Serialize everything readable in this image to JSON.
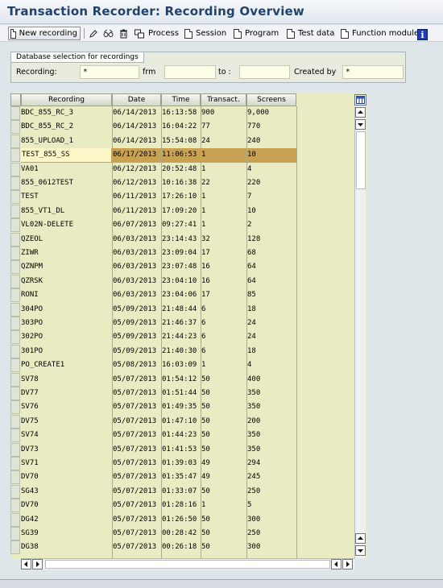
{
  "title": "Transaction Recorder: Recording Overview",
  "toolbar": {
    "new_recording": "New recording",
    "process": "Process",
    "session": "Session",
    "program": "Program",
    "test_data": "Test data",
    "function_module": "Function module"
  },
  "selection": {
    "group_title": "Database selection for recordings",
    "recording_label": "Recording:",
    "recording_value": "*",
    "from_label": "frm",
    "from_value": "",
    "to_label": "to :",
    "to_value": "",
    "created_by_label": "Created by",
    "created_by_value": "*"
  },
  "grid": {
    "columns": [
      "Recording",
      "Date",
      "Time",
      "Transact.",
      "Screens"
    ],
    "selected_row": 3,
    "rows": [
      [
        "BDC_855_RC_3",
        "06/14/2013",
        "16:13:58",
        "900",
        "9,000"
      ],
      [
        "BDC_855_RC_2",
        "06/14/2013",
        "16:04:22",
        "77",
        "770"
      ],
      [
        "855_UPLOAD_1",
        "06/14/2013",
        "15:54:08",
        "24",
        "240"
      ],
      [
        "TEST_855_SS",
        "06/17/2013",
        "11:06:53",
        "1",
        "10"
      ],
      [
        "VA01",
        "06/12/2013",
        "20:52:48",
        "1",
        "4"
      ],
      [
        "855_0612TEST",
        "06/12/2013",
        "10:16:38",
        "22",
        "220"
      ],
      [
        "TEST",
        "06/11/2013",
        "17:26:10",
        "1",
        "7"
      ],
      [
        "855_VT1_DL",
        "06/11/2013",
        "17:09:20",
        "1",
        "10"
      ],
      [
        "VL02N-DELETE",
        "06/07/2013",
        "09:27:41",
        "1",
        "2"
      ],
      [
        "QZEOL",
        "06/03/2013",
        "23:14:43",
        "32",
        "128"
      ],
      [
        "ZIWR",
        "06/03/2013",
        "23:09:04",
        "17",
        "68"
      ],
      [
        "QZNPM",
        "06/03/2013",
        "23:07:48",
        "16",
        "64"
      ],
      [
        "QZRSK",
        "06/03/2013",
        "23:04:10",
        "16",
        "64"
      ],
      [
        "RONI",
        "06/03/2013",
        "23:04:06",
        "17",
        "85"
      ],
      [
        "304PO",
        "05/09/2013",
        "21:48:44",
        "6",
        "18"
      ],
      [
        "303PO",
        "05/09/2013",
        "21:46:37",
        "6",
        "24"
      ],
      [
        "302PO",
        "05/09/2013",
        "21:44:23",
        "6",
        "24"
      ],
      [
        "301PO",
        "05/09/2013",
        "21:40:30",
        "6",
        "18"
      ],
      [
        "PO_CREATE1",
        "05/08/2013",
        "16:03:09",
        "1",
        "4"
      ],
      [
        "SV78",
        "05/07/2013",
        "01:54:12",
        "50",
        "400"
      ],
      [
        "DV77",
        "05/07/2013",
        "01:51:44",
        "50",
        "350"
      ],
      [
        "SV76",
        "05/07/2013",
        "01:49:35",
        "50",
        "350"
      ],
      [
        "DV75",
        "05/07/2013",
        "01:47:10",
        "50",
        "200"
      ],
      [
        "SV74",
        "05/07/2013",
        "01:44:23",
        "50",
        "350"
      ],
      [
        "DV73",
        "05/07/2013",
        "01:41:53",
        "50",
        "350"
      ],
      [
        "SV71",
        "05/07/2013",
        "01:39:03",
        "49",
        "294"
      ],
      [
        "DV70",
        "05/07/2013",
        "01:35:47",
        "49",
        "245"
      ],
      [
        "SG43",
        "05/07/2013",
        "01:33:07",
        "50",
        "250"
      ],
      [
        "DV70",
        "05/07/2013",
        "01:28:16",
        "1",
        "5"
      ],
      [
        "DG42",
        "05/07/2013",
        "01:26:50",
        "50",
        "300"
      ],
      [
        "SG39",
        "05/07/2013",
        "00:28:42",
        "50",
        "250"
      ],
      [
        "DG38",
        "05/07/2013",
        "00:26:18",
        "50",
        "300"
      ]
    ]
  },
  "colors": {
    "title": "#24436a",
    "grid_bg": "#e9ebc3",
    "row_highlight": "#fdf6c8",
    "selected_bg": "#c9a152",
    "field_bg": "#fdfde8"
  }
}
